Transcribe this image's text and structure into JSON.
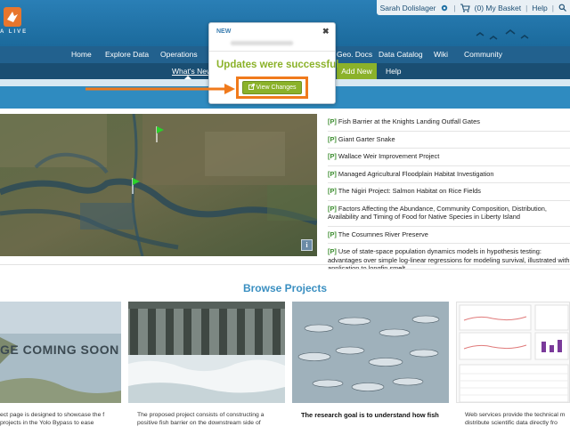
{
  "logo": {
    "text": "A LIVE"
  },
  "topbar": {
    "user": "Sarah Dolislager",
    "basket": "(0) My Basket",
    "help": "Help",
    "separator": "|"
  },
  "nav": {
    "items": [
      "Home",
      "Explore Data",
      "Operations",
      "Geo. Docs",
      "Data Catalog",
      "Wiki",
      "Community"
    ]
  },
  "subnav": {
    "whats_new": "What's New",
    "add_new": "Add New",
    "help": "Help"
  },
  "modal": {
    "header": "NEW",
    "close": "✖",
    "message": "Updates were successful.",
    "button": "View Changes"
  },
  "map": {
    "info_label": "i"
  },
  "projects": [
    {
      "tag": "[P]",
      "title": "Fish Barrier at the Knights Landing Outfall Gates"
    },
    {
      "tag": "[P]",
      "title": "Giant Garter Snake"
    },
    {
      "tag": "[P]",
      "title": "Wallace Weir Improvement Project"
    },
    {
      "tag": "[P]",
      "title": "Managed Agricultural Floodplain Habitat Investigation"
    },
    {
      "tag": "[P]",
      "title": "The Nigiri Project: Salmon Habitat on Rice Fields"
    },
    {
      "tag": "[P]",
      "title": "Factors Affecting the Abundance, Community Composition, Distribution, Availability and Timing of Food for Native Species in Liberty Island"
    },
    {
      "tag": "[P]",
      "title": "The Cosumnes River Preserve"
    },
    {
      "tag": "[P]",
      "title": "Use of state-space population dynamics models in hypothesis testing: advantages over simple log-linear regressions for modeling survival, illustrated with application to longfin smelt"
    }
  ],
  "browse": {
    "title": "Browse Projects",
    "cards": [
      {
        "image_text": "GE COMING SOON",
        "desc": "ect page is designed to showcase the f projects in the Yolo Bypass to ease"
      },
      {
        "desc": "The proposed project consists of constructing a positive fish barrier on the downstream side of"
      },
      {
        "desc": "The research goal is to understand how fish"
      },
      {
        "desc": "Web services provide the technical m distribute scientific data directly fro"
      }
    ]
  },
  "colors": {
    "banner": "#1d6fa3",
    "nav": "#22618e",
    "subnav": "#1a4e72",
    "accent_green": "#8bb22a",
    "highlight_orange": "#f07a1c",
    "title_blue": "#3a8fc1"
  }
}
